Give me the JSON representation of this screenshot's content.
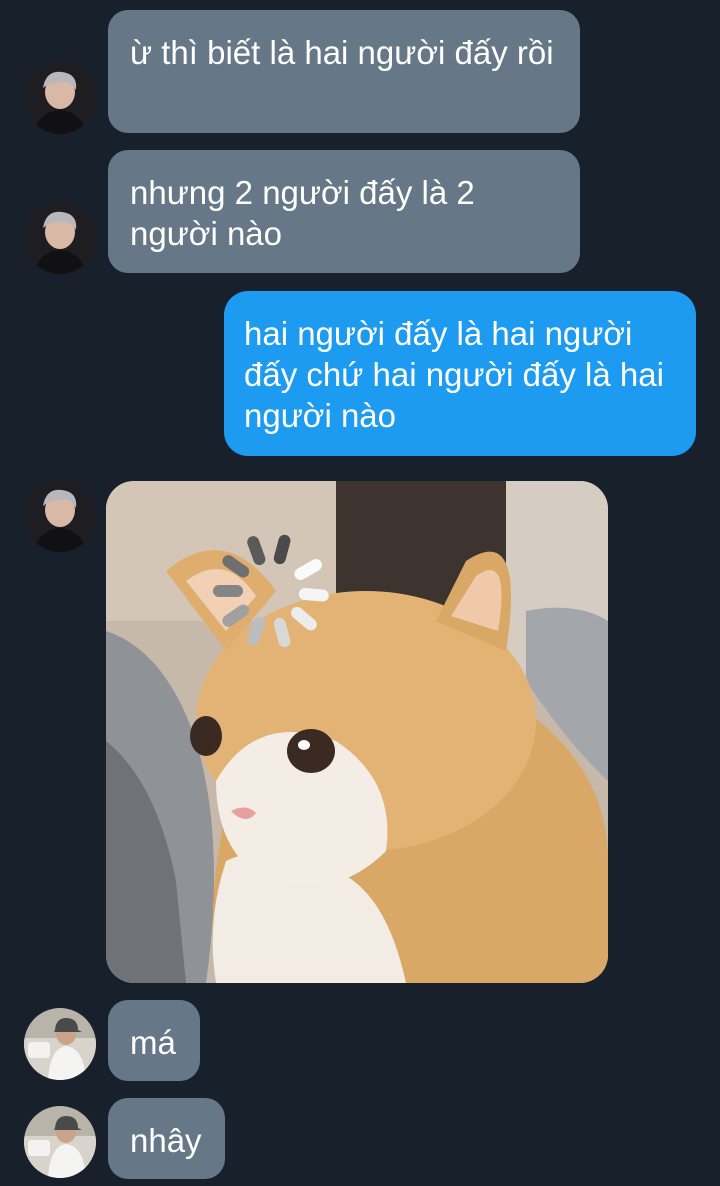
{
  "conversation": {
    "messages": [
      {
        "direction": "incoming",
        "sender_avatar": "avatar-woman-dark",
        "text": "ừ thì biết là hai người đấy rồi"
      },
      {
        "direction": "incoming",
        "sender_avatar": "avatar-woman-dark",
        "text": "nhưng 2 người đấy là 2 người nào"
      },
      {
        "direction": "outgoing",
        "text": "hai người đấy là hai người đấy chứ hai người đấy là hai người nào"
      },
      {
        "direction": "incoming",
        "sender_avatar": "avatar-woman-dark",
        "attachment": "cat-loading-meme-image"
      },
      {
        "direction": "incoming",
        "sender_avatar": "avatar-man-cap",
        "text": "má"
      },
      {
        "direction": "incoming",
        "sender_avatar": "avatar-man-cap",
        "text": "nhây"
      }
    ]
  },
  "colors": {
    "background": "#18202b",
    "incoming_bubble": "#667787",
    "outgoing_bubble": "#1d9bf0",
    "text": "#ffffff"
  }
}
